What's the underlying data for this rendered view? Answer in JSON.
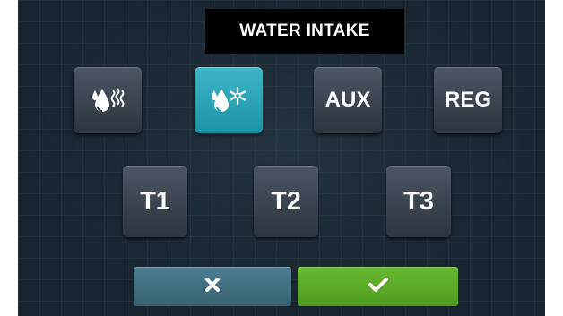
{
  "header": {
    "title": "WATER INTAKE"
  },
  "buttons_row1": [
    {
      "id": "hot-water",
      "label": "",
      "icon": "hot-water-drops-icon",
      "active": false
    },
    {
      "id": "cold-water",
      "label": "",
      "icon": "cold-water-drops-icon",
      "active": true
    },
    {
      "id": "aux",
      "label": "AUX",
      "active": false
    },
    {
      "id": "reg",
      "label": "REG",
      "active": false
    }
  ],
  "buttons_row2": [
    {
      "id": "t1",
      "label": "T1"
    },
    {
      "id": "t2",
      "label": "T2"
    },
    {
      "id": "t3",
      "label": "T3"
    }
  ],
  "actions": {
    "cancel_icon": "close-icon",
    "confirm_icon": "checkmark-icon"
  },
  "colors": {
    "background": "#18242d",
    "button": "#3c444e",
    "active_button": "#2aa4b6",
    "cancel": "#44707f",
    "confirm": "#5eab2b"
  }
}
